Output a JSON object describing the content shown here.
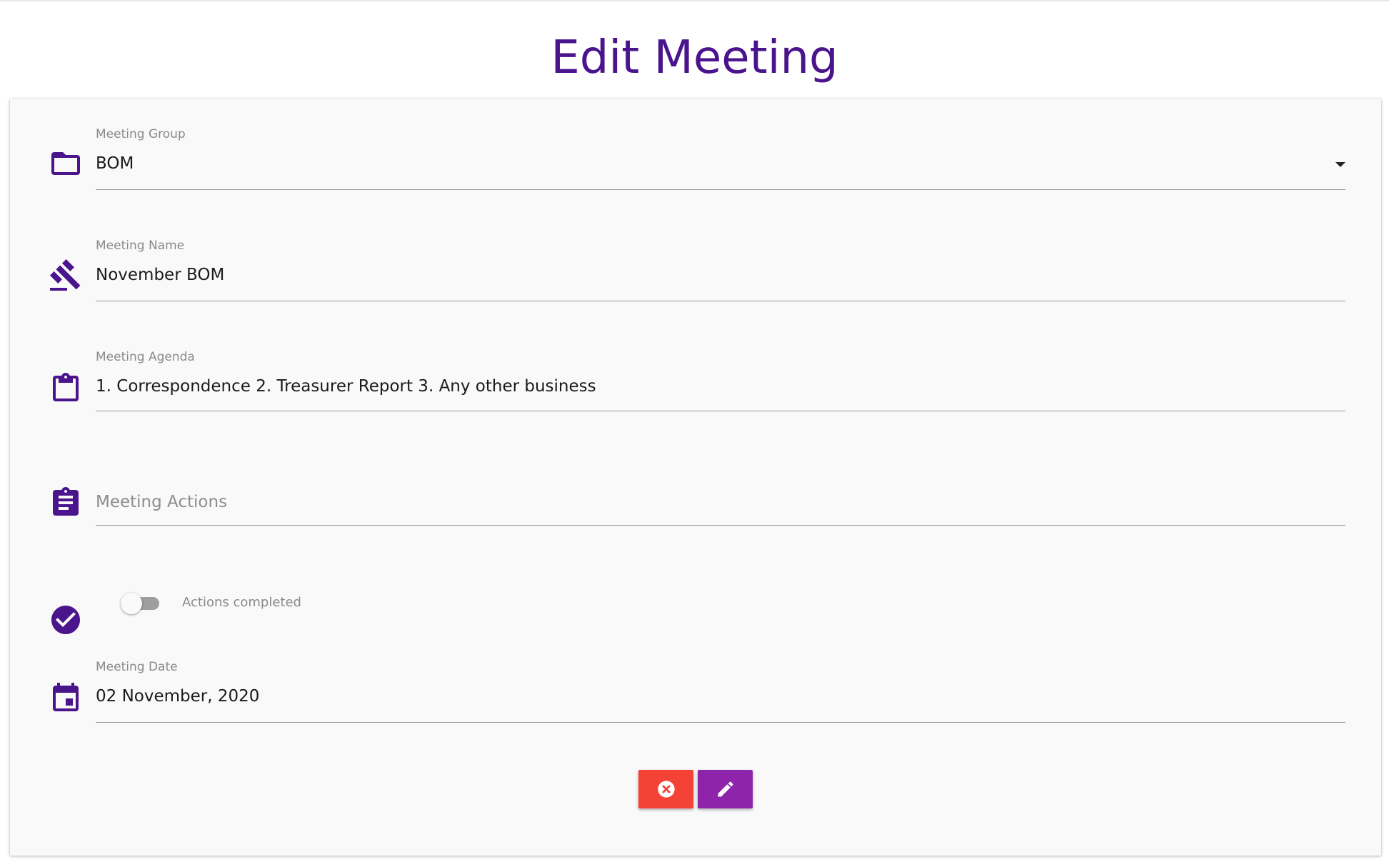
{
  "page": {
    "title": "Edit Meeting"
  },
  "colors": {
    "accent": "#4a148c",
    "cancel": "#f44336",
    "edit": "#8e24aa"
  },
  "form": {
    "meeting_group": {
      "label": "Meeting Group",
      "value": "BOM",
      "icon": "folder-icon"
    },
    "meeting_name": {
      "label": "Meeting Name",
      "value": "November BOM",
      "icon": "gavel-icon"
    },
    "meeting_agenda": {
      "label": "Meeting Agenda",
      "value": "1. Correspondence 2. Treasurer Report 3. Any other business",
      "icon": "clipboard-icon"
    },
    "meeting_actions": {
      "placeholder": "Meeting Actions",
      "value": "",
      "icon": "assignment-icon"
    },
    "actions_completed": {
      "label": "Actions completed",
      "checked": false,
      "icon": "check-circle-icon"
    },
    "meeting_date": {
      "label": "Meeting Date",
      "value": "02 November, 2020",
      "icon": "calendar-icon"
    }
  },
  "buttons": {
    "cancel_icon": "cancel-circle-icon",
    "edit_icon": "pencil-icon"
  }
}
